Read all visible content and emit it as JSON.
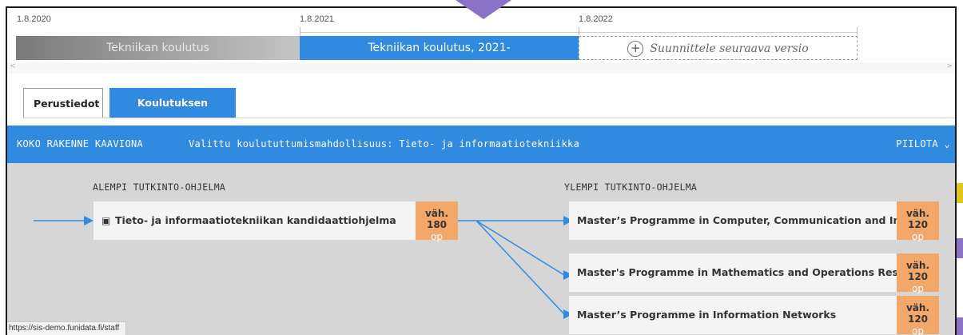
{
  "timeline": {
    "dates": [
      "1.8.2020",
      "1.8.2021",
      "1.8.2022"
    ],
    "versions": [
      {
        "label": "Tekniikan koulutus"
      },
      {
        "label": "Tekniikan koulutus, 2021-"
      },
      {
        "label": "Suunnittele seuraava versio",
        "icon": "plus-circle-icon"
      }
    ]
  },
  "tabs": [
    {
      "label": "Perustiedot"
    },
    {
      "label": "Koulutuksen rakenne"
    }
  ],
  "structure_bar": {
    "chart_link": "KOKO RAKENNE KAAVIONA",
    "selection": "Valittu koulututtumismahdollisuus: Tieto- ja informaatiotekniikka",
    "hide": "PIILOTA"
  },
  "diagram": {
    "lower_heading": "ALEMPI TUTKINTO-OHJELMA",
    "upper_heading": "YLEMPI TUTKINTO-OHJELMA",
    "lower_programme": {
      "name": "Tieto- ja informaatiotekniikan kandidaattiohjelma",
      "credits": "väh. 180",
      "unit": "op"
    },
    "upper_programmes": [
      {
        "name": "Master’s Programme in Computer, Communication and Informatio",
        "credits": "väh. 120",
        "unit": "op"
      },
      {
        "name": "Master's Programme in Mathematics and Operations Research",
        "credits": "väh. 120",
        "unit": "op"
      },
      {
        "name": "Master’s Programme in Information Networks",
        "credits": "väh. 120",
        "unit": "op"
      }
    ]
  },
  "status_url": "https://sis-demo.funidata.fi/staff",
  "colors": {
    "accent": "#2f8ae0",
    "credits": "#f3a86a",
    "pointer": "#8a73c7"
  }
}
